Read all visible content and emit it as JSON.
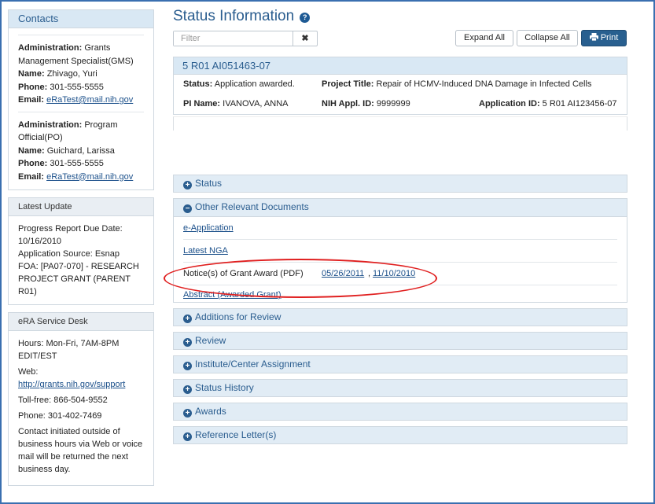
{
  "contacts": {
    "title": "Contacts",
    "gms": {
      "admin_label": "Administration:",
      "admin_value": "Grants Management Specialist(GMS)",
      "name_label": "Name:",
      "name_value": "Zhivago, Yuri",
      "phone_label": "Phone:",
      "phone_value": "301-555-5555",
      "email_label": "Email:",
      "email_value": "eRaTest@mail.nih.gov"
    },
    "po": {
      "admin_label": "Administration:",
      "admin_value": "Program Official(PO)",
      "name_label": "Name:",
      "name_value": "Guichard, Larissa",
      "phone_label": "Phone:",
      "phone_value": "301-555-5555",
      "email_label": "Email:",
      "email_value": "eRaTest@mail.nih.gov"
    }
  },
  "latest_update": {
    "title": "Latest Update",
    "line1": "Progress Report Due Date: 10/16/2010",
    "line2": "Application Source: Esnap",
    "line3": "FOA: [PA07-070] - RESEARCH PROJECT GRANT (PARENT R01)"
  },
  "service_desk": {
    "title": "eRA Service Desk",
    "hours": "Hours: Mon-Fri, 7AM-8PM EDIT/EST",
    "web_label": "Web:",
    "web_link": "http://grants.nih.gov/support",
    "tollfree": "Toll-free: 866-504-9552",
    "phone": "Phone: 301-402-7469",
    "note": "Contact initiated outside of business hours via Web or voice mail will be returned the next business day."
  },
  "main": {
    "title": "Status Information",
    "help_glyph": "?",
    "filter_placeholder": "Filter",
    "filter_clear": "✖",
    "expand_all": "Expand All",
    "collapse_all": "Collapse All",
    "print": "Print",
    "print_icon": "printer-icon"
  },
  "summary": {
    "grant_number": "5 R01 AI051463-07",
    "status_label": "Status:",
    "status_value": "Application awarded.",
    "project_title_label": "Project Title:",
    "project_title_value": "Repair of HCMV-Induced DNA Damage in Infected Cells",
    "pi_label": "PI Name:",
    "pi_value": "IVANOVA, ANNA",
    "appl_id_label": "NIH Appl. ID:",
    "appl_id_value": "9999999",
    "application_id_label": "Application ID:",
    "application_id_value": "5 R01 AI123456-07"
  },
  "sections": {
    "status": "Status",
    "other_docs": "Other Relevant Documents",
    "additions": "Additions for Review",
    "review": "Review",
    "institute": "Institute/Center Assignment",
    "status_history": "Status History",
    "awards": "Awards",
    "reference_letters": "Reference Letter(s)"
  },
  "documents": {
    "e_application": "e-Application",
    "latest_nga": "Latest NGA",
    "noa_label": "Notice(s) of Grant Award (PDF)",
    "noa_date1": "05/26/2011",
    "noa_sep": ",",
    "noa_date2": "11/10/2010",
    "abstract": "Abstract (Awarded Grant)"
  },
  "colors": {
    "accent": "#2a5d8f",
    "annotation": "#e02020",
    "print_button": "#285f8f"
  }
}
